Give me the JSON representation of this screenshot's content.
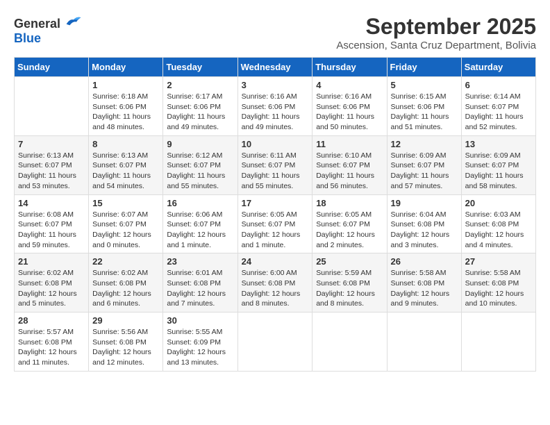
{
  "logo": {
    "general": "General",
    "blue": "Blue"
  },
  "title": "September 2025",
  "subtitle": "Ascension, Santa Cruz Department, Bolivia",
  "days_of_week": [
    "Sunday",
    "Monday",
    "Tuesday",
    "Wednesday",
    "Thursday",
    "Friday",
    "Saturday"
  ],
  "weeks": [
    [
      {
        "day": "",
        "info": ""
      },
      {
        "day": "1",
        "info": "Sunrise: 6:18 AM\nSunset: 6:06 PM\nDaylight: 11 hours\nand 48 minutes."
      },
      {
        "day": "2",
        "info": "Sunrise: 6:17 AM\nSunset: 6:06 PM\nDaylight: 11 hours\nand 49 minutes."
      },
      {
        "day": "3",
        "info": "Sunrise: 6:16 AM\nSunset: 6:06 PM\nDaylight: 11 hours\nand 49 minutes."
      },
      {
        "day": "4",
        "info": "Sunrise: 6:16 AM\nSunset: 6:06 PM\nDaylight: 11 hours\nand 50 minutes."
      },
      {
        "day": "5",
        "info": "Sunrise: 6:15 AM\nSunset: 6:06 PM\nDaylight: 11 hours\nand 51 minutes."
      },
      {
        "day": "6",
        "info": "Sunrise: 6:14 AM\nSunset: 6:07 PM\nDaylight: 11 hours\nand 52 minutes."
      }
    ],
    [
      {
        "day": "7",
        "info": "Sunrise: 6:13 AM\nSunset: 6:07 PM\nDaylight: 11 hours\nand 53 minutes."
      },
      {
        "day": "8",
        "info": "Sunrise: 6:13 AM\nSunset: 6:07 PM\nDaylight: 11 hours\nand 54 minutes."
      },
      {
        "day": "9",
        "info": "Sunrise: 6:12 AM\nSunset: 6:07 PM\nDaylight: 11 hours\nand 55 minutes."
      },
      {
        "day": "10",
        "info": "Sunrise: 6:11 AM\nSunset: 6:07 PM\nDaylight: 11 hours\nand 55 minutes."
      },
      {
        "day": "11",
        "info": "Sunrise: 6:10 AM\nSunset: 6:07 PM\nDaylight: 11 hours\nand 56 minutes."
      },
      {
        "day": "12",
        "info": "Sunrise: 6:09 AM\nSunset: 6:07 PM\nDaylight: 11 hours\nand 57 minutes."
      },
      {
        "day": "13",
        "info": "Sunrise: 6:09 AM\nSunset: 6:07 PM\nDaylight: 11 hours\nand 58 minutes."
      }
    ],
    [
      {
        "day": "14",
        "info": "Sunrise: 6:08 AM\nSunset: 6:07 PM\nDaylight: 11 hours\nand 59 minutes."
      },
      {
        "day": "15",
        "info": "Sunrise: 6:07 AM\nSunset: 6:07 PM\nDaylight: 12 hours\nand 0 minutes."
      },
      {
        "day": "16",
        "info": "Sunrise: 6:06 AM\nSunset: 6:07 PM\nDaylight: 12 hours\nand 1 minute."
      },
      {
        "day": "17",
        "info": "Sunrise: 6:05 AM\nSunset: 6:07 PM\nDaylight: 12 hours\nand 1 minute."
      },
      {
        "day": "18",
        "info": "Sunrise: 6:05 AM\nSunset: 6:07 PM\nDaylight: 12 hours\nand 2 minutes."
      },
      {
        "day": "19",
        "info": "Sunrise: 6:04 AM\nSunset: 6:08 PM\nDaylight: 12 hours\nand 3 minutes."
      },
      {
        "day": "20",
        "info": "Sunrise: 6:03 AM\nSunset: 6:08 PM\nDaylight: 12 hours\nand 4 minutes."
      }
    ],
    [
      {
        "day": "21",
        "info": "Sunrise: 6:02 AM\nSunset: 6:08 PM\nDaylight: 12 hours\nand 5 minutes."
      },
      {
        "day": "22",
        "info": "Sunrise: 6:02 AM\nSunset: 6:08 PM\nDaylight: 12 hours\nand 6 minutes."
      },
      {
        "day": "23",
        "info": "Sunrise: 6:01 AM\nSunset: 6:08 PM\nDaylight: 12 hours\nand 7 minutes."
      },
      {
        "day": "24",
        "info": "Sunrise: 6:00 AM\nSunset: 6:08 PM\nDaylight: 12 hours\nand 8 minutes."
      },
      {
        "day": "25",
        "info": "Sunrise: 5:59 AM\nSunset: 6:08 PM\nDaylight: 12 hours\nand 8 minutes."
      },
      {
        "day": "26",
        "info": "Sunrise: 5:58 AM\nSunset: 6:08 PM\nDaylight: 12 hours\nand 9 minutes."
      },
      {
        "day": "27",
        "info": "Sunrise: 5:58 AM\nSunset: 6:08 PM\nDaylight: 12 hours\nand 10 minutes."
      }
    ],
    [
      {
        "day": "28",
        "info": "Sunrise: 5:57 AM\nSunset: 6:08 PM\nDaylight: 12 hours\nand 11 minutes."
      },
      {
        "day": "29",
        "info": "Sunrise: 5:56 AM\nSunset: 6:08 PM\nDaylight: 12 hours\nand 12 minutes."
      },
      {
        "day": "30",
        "info": "Sunrise: 5:55 AM\nSunset: 6:09 PM\nDaylight: 12 hours\nand 13 minutes."
      },
      {
        "day": "",
        "info": ""
      },
      {
        "day": "",
        "info": ""
      },
      {
        "day": "",
        "info": ""
      },
      {
        "day": "",
        "info": ""
      }
    ]
  ]
}
